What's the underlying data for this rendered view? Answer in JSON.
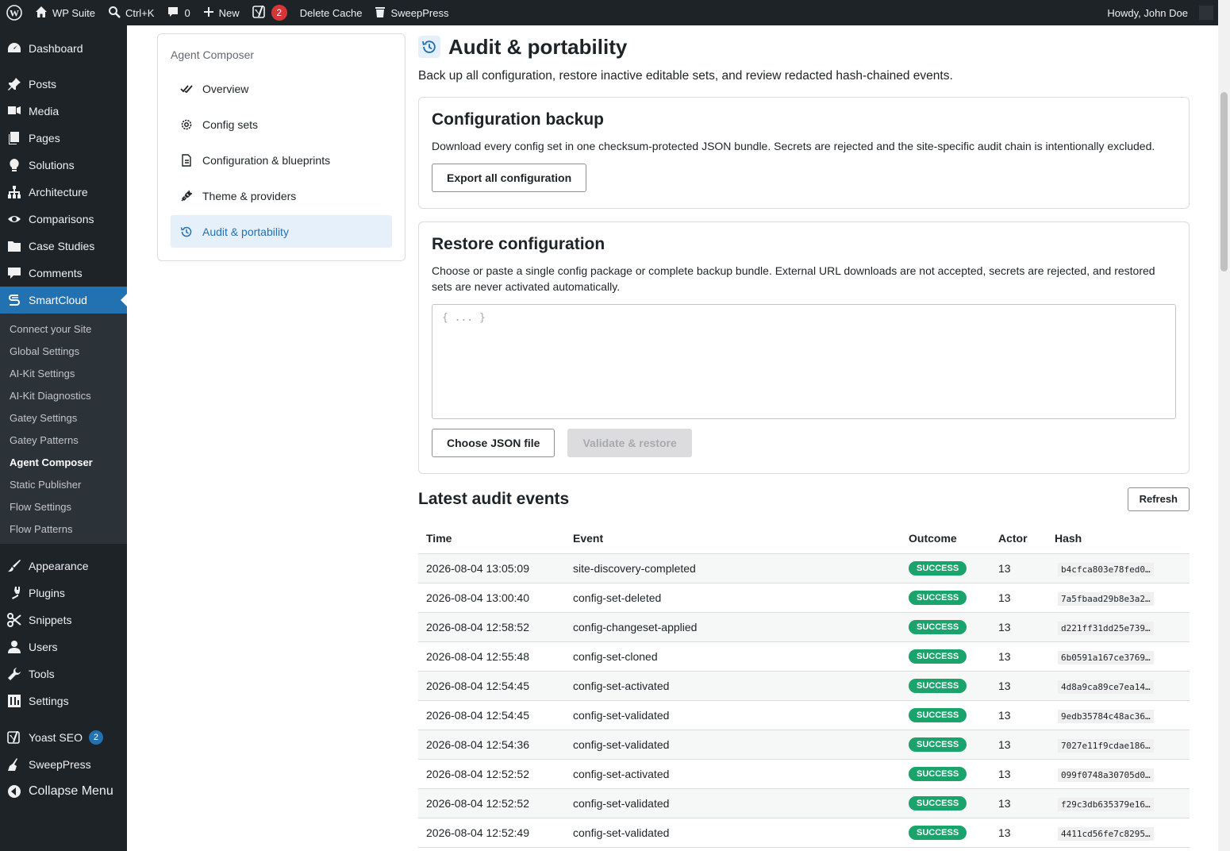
{
  "adminbar": {
    "site": "WP Suite",
    "search": "Ctrl+K",
    "comments": "0",
    "new": "New",
    "yoast_count": "2",
    "cache": "Delete Cache",
    "sweeppress": "SweepPress",
    "howdy": "Howdy, John Doe"
  },
  "sidebar": {
    "top": [
      "Dashboard"
    ],
    "items": [
      "Posts",
      "Media",
      "Pages",
      "Solutions",
      "Architecture",
      "Comparisons",
      "Case Studies",
      "Comments"
    ],
    "current": "SmartCloud",
    "submenu": [
      "Connect your Site",
      "Global Settings",
      "AI-Kit Settings",
      "AI-Kit Diagnostics",
      "Gatey Settings",
      "Gatey Patterns",
      "Agent Composer",
      "Static Publisher",
      "Flow Settings",
      "Flow Patterns"
    ],
    "lower": [
      "Appearance",
      "Plugins",
      "Snippets",
      "Users",
      "Tools",
      "Settings"
    ],
    "yoast": "Yoast SEO",
    "yoast_count": "2",
    "sweeppress": "SweepPress",
    "collapse": "Collapse Menu"
  },
  "subnav": {
    "title": "Agent Composer",
    "items": [
      "Overview",
      "Config sets",
      "Configuration & blueprints",
      "Theme & providers",
      "Audit & portability"
    ]
  },
  "page": {
    "title": "Audit & portability",
    "description": "Back up all configuration, restore inactive editable sets, and review redacted hash-chained events."
  },
  "backup": {
    "title": "Configuration backup",
    "text": "Download every config set in one checksum-protected JSON bundle. Secrets are rejected and the site-specific audit chain is intentionally excluded.",
    "button": "Export all configuration"
  },
  "restore": {
    "title": "Restore configuration",
    "text": "Choose or paste a single config package or complete backup bundle. External URL downloads are not accepted, secrets are rejected, and restored sets are never activated automatically.",
    "placeholder": "{ ... }",
    "choose": "Choose JSON file",
    "validate": "Validate & restore"
  },
  "events": {
    "title": "Latest audit events",
    "refresh": "Refresh",
    "columns": [
      "Time",
      "Event",
      "Outcome",
      "Actor",
      "Hash"
    ],
    "rows": [
      [
        "2026-08-04 13:05:09",
        "site-discovery-completed",
        "SUCCESS",
        "13",
        "b4cfca803e78fed0…"
      ],
      [
        "2026-08-04 13:00:40",
        "config-set-deleted",
        "SUCCESS",
        "13",
        "7a5fbaad29b8e3a2…"
      ],
      [
        "2026-08-04 12:58:52",
        "config-changeset-applied",
        "SUCCESS",
        "13",
        "d221ff31dd25e739…"
      ],
      [
        "2026-08-04 12:55:48",
        "config-set-cloned",
        "SUCCESS",
        "13",
        "6b0591a167ce3769…"
      ],
      [
        "2026-08-04 12:54:45",
        "config-set-activated",
        "SUCCESS",
        "13",
        "4d8a9ca89ce7ea14…"
      ],
      [
        "2026-08-04 12:54:45",
        "config-set-validated",
        "SUCCESS",
        "13",
        "9edb35784c48ac36…"
      ],
      [
        "2026-08-04 12:54:36",
        "config-set-validated",
        "SUCCESS",
        "13",
        "7027e11f9cdae186…"
      ],
      [
        "2026-08-04 12:52:52",
        "config-set-activated",
        "SUCCESS",
        "13",
        "099f0748a30705d0…"
      ],
      [
        "2026-08-04 12:52:52",
        "config-set-validated",
        "SUCCESS",
        "13",
        "f29c3db635379e16…"
      ],
      [
        "2026-08-04 12:52:49",
        "config-set-validated",
        "SUCCESS",
        "13",
        "4411cd56fe7c8295…"
      ]
    ]
  }
}
